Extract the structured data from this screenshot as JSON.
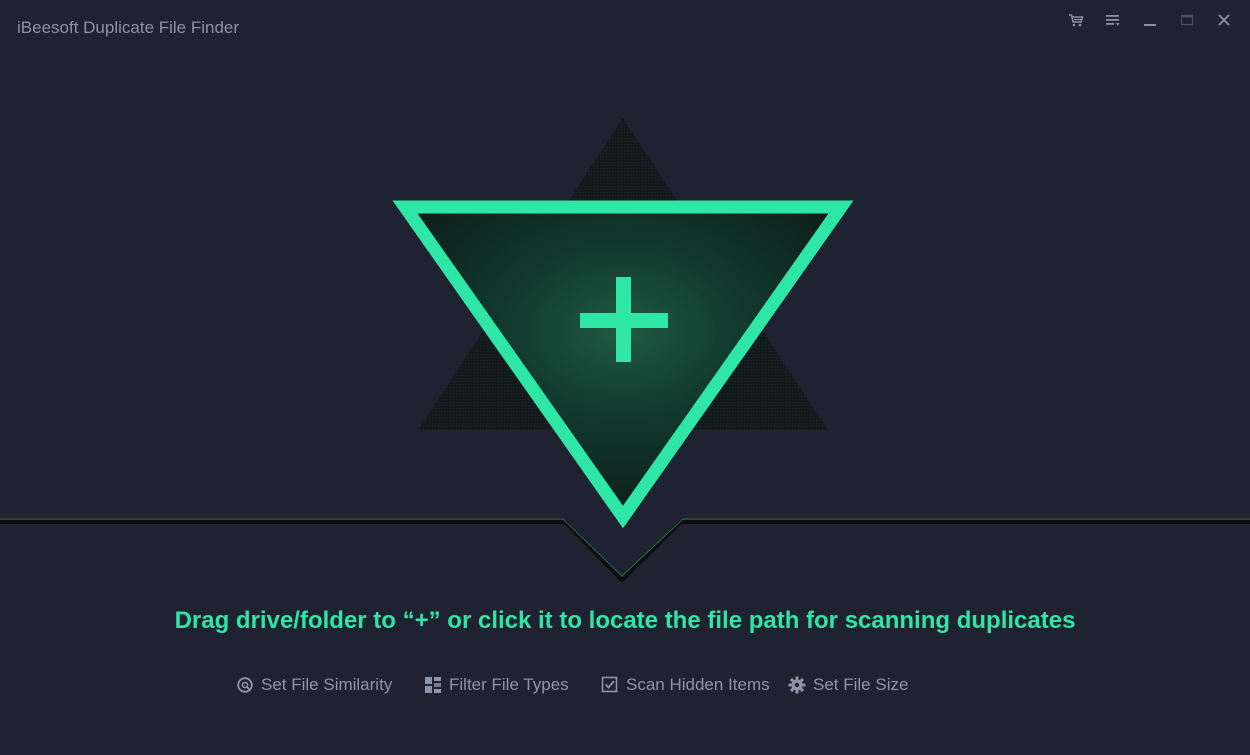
{
  "window": {
    "title": "iBeesoft Duplicate File Finder",
    "controls": [
      "cart-icon",
      "menu-icon",
      "minimize-icon",
      "maximize-icon",
      "close-icon"
    ]
  },
  "main": {
    "add_symbol": "+",
    "prompt": "Drag drive/folder to “+” or click it to locate the file path for scanning duplicates"
  },
  "options": [
    {
      "label": "Set File Similarity",
      "icon": "similarity-icon"
    },
    {
      "label": "Filter File Types",
      "icon": "grid-icon"
    },
    {
      "label": "Scan Hidden Items",
      "icon": "checkbox-icon"
    },
    {
      "label": "Set File Size",
      "icon": "gear-icon"
    }
  ],
  "colors": {
    "background": "#1f2230",
    "accent": "#2ee6a6",
    "title_text": "#8a93a6",
    "option_text": "#8a96ab"
  }
}
